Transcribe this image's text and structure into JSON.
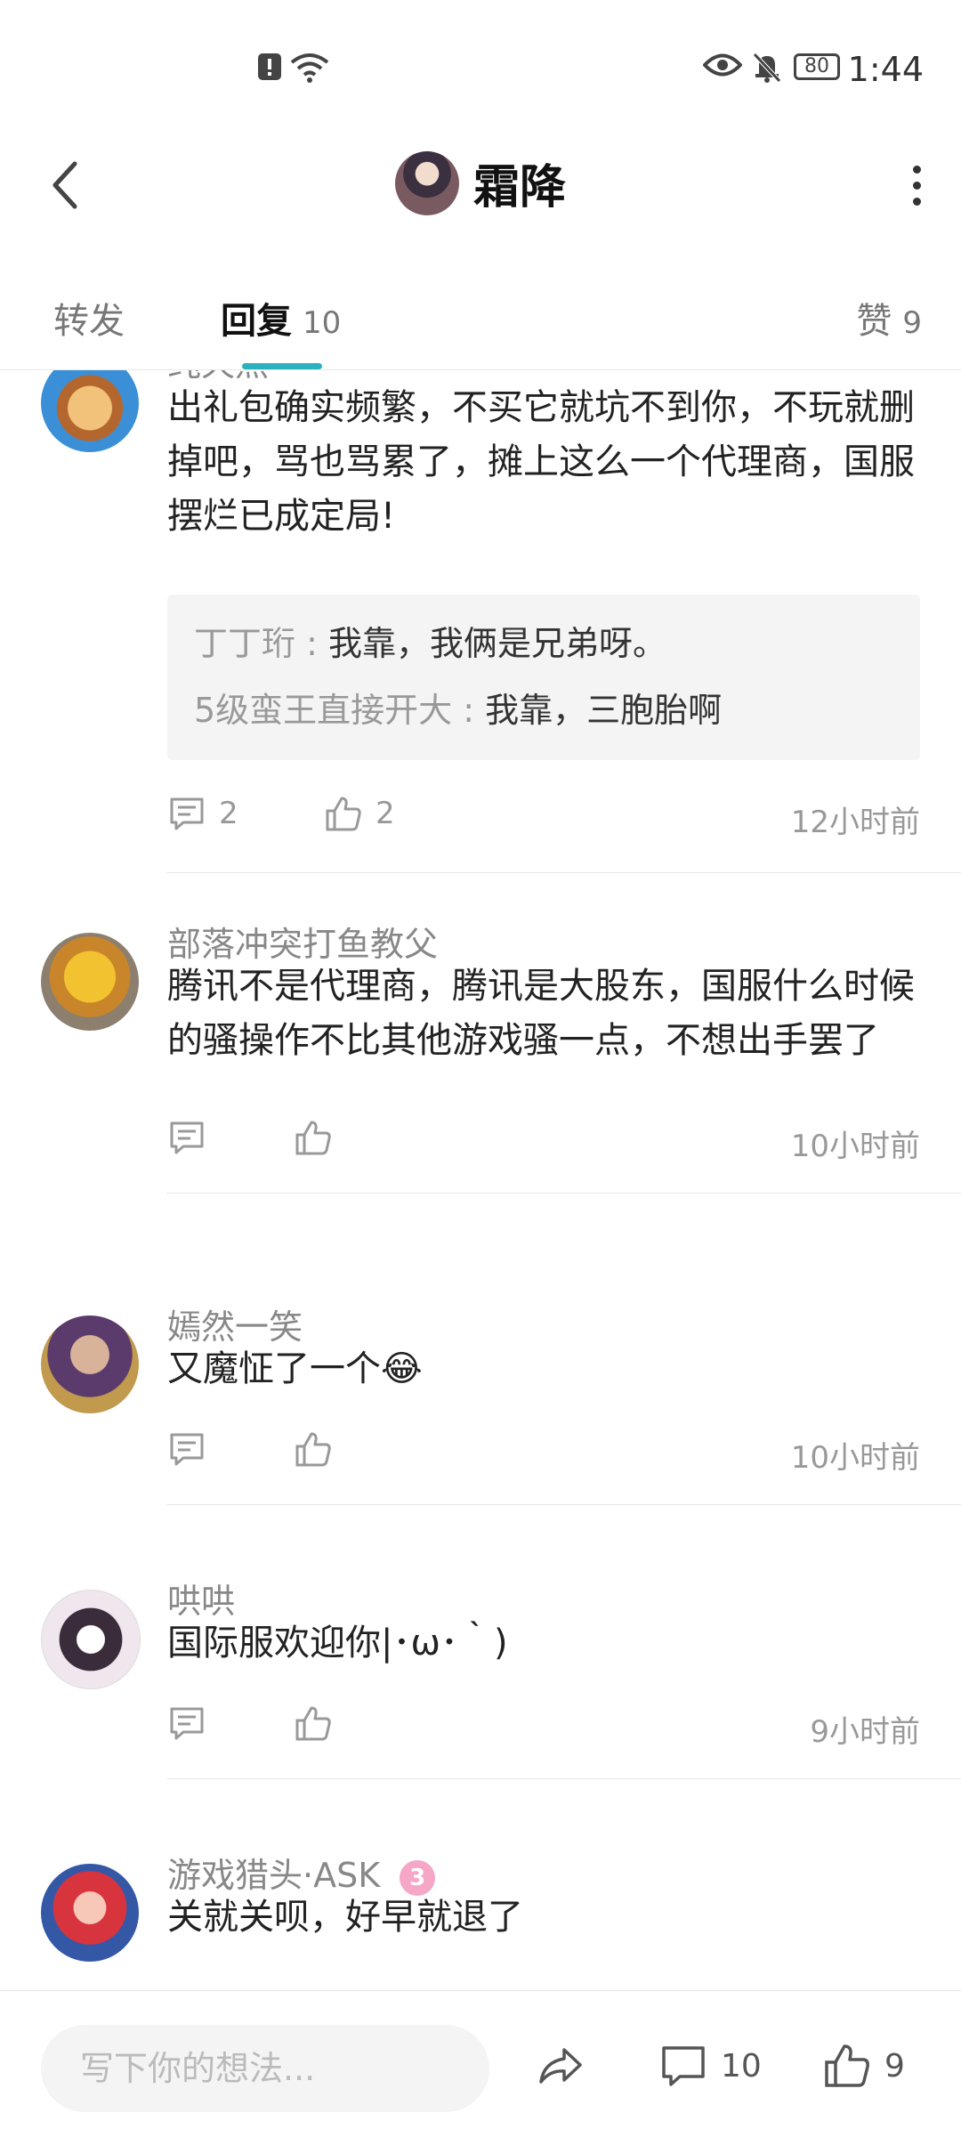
{
  "status_bar": {
    "time": "1:44",
    "battery": "80"
  },
  "header": {
    "title": "霜降"
  },
  "tabs": [
    {
      "label": "转发",
      "count": ""
    },
    {
      "label": "回复",
      "count": "10"
    },
    {
      "label": "赞",
      "count": "9"
    }
  ],
  "comments": [
    {
      "username": "纯天然",
      "text": "出礼包确实频繁，不买它就坑不到你，不玩就删掉吧，骂也骂累了，摊上这么一个代理商，国服摆烂已成定局!",
      "quotes": [
        {
          "name": "丁丁珩",
          "text": "我靠，我俩是兄弟呀。"
        },
        {
          "name": "5级蛮王直接开大",
          "text": "我靠，三胞胎啊"
        }
      ],
      "reply_count": "2",
      "like_count": "2",
      "time": "12小时前"
    },
    {
      "username": "部落冲突打鱼教父",
      "text": "腾讯不是代理商，腾讯是大股东，国服什么时候的骚操作不比其他游戏骚一点，不想出手罢了",
      "reply_count": "",
      "like_count": "",
      "time": "10小时前"
    },
    {
      "username": "嫣然一笑",
      "text": "又魔怔了一个",
      "emoji": "😂",
      "reply_count": "",
      "like_count": "",
      "time": "10小时前"
    },
    {
      "username": "哄哄",
      "text": "国际服欢迎你|･ω･｀)",
      "reply_count": "",
      "like_count": "",
      "time": "9小时前"
    },
    {
      "username": "游戏猎头·ASK",
      "text": "关就关呗，好早就退了",
      "reply_count": "",
      "like_count": "",
      "time": ""
    }
  ],
  "bottom_bar": {
    "placeholder": "写下你的想法...",
    "comment_count": "10",
    "like_count": "9"
  },
  "colors": {
    "accent": "#2bb2be",
    "text": "#222222",
    "muted": "#999999"
  }
}
